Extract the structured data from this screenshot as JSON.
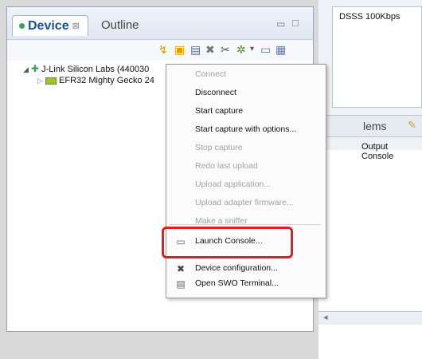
{
  "left_panel": {
    "tabs": {
      "device": "Device",
      "outline": "Outline"
    },
    "tree": [
      "J-Link Silicon Labs (440030",
      "EFR32 Mighty Gecko 24"
    ]
  },
  "right_panel": {
    "dsss_label": "DSSS 100Kbps",
    "problems_tab": "lems",
    "output_console_tab": "Output Console"
  },
  "context_menu": {
    "items": [
      {
        "label": "Connect",
        "enabled": false
      },
      {
        "label": "Disconnect",
        "enabled": true
      },
      {
        "label": "Start capture",
        "enabled": true
      },
      {
        "label": "Start capture with options...",
        "enabled": true
      },
      {
        "label": "Stop capture",
        "enabled": false
      },
      {
        "label": "Redo last upload",
        "enabled": false
      },
      {
        "label": "Upload application...",
        "enabled": false
      },
      {
        "label": "Upload adapter firmware...",
        "enabled": false
      },
      {
        "label": "Make a sniffer",
        "enabled": false
      },
      {
        "label": "Launch Console...",
        "enabled": true,
        "icon": "console-icon"
      },
      {
        "label": "Device configuration...",
        "enabled": true,
        "icon": "wrench-icon"
      },
      {
        "label": "Open SWO Terminal...",
        "enabled": true,
        "icon": "terminal-icon"
      }
    ]
  },
  "colors": {
    "highlight": "#e02020",
    "tab_title": "#1a4f9c"
  }
}
